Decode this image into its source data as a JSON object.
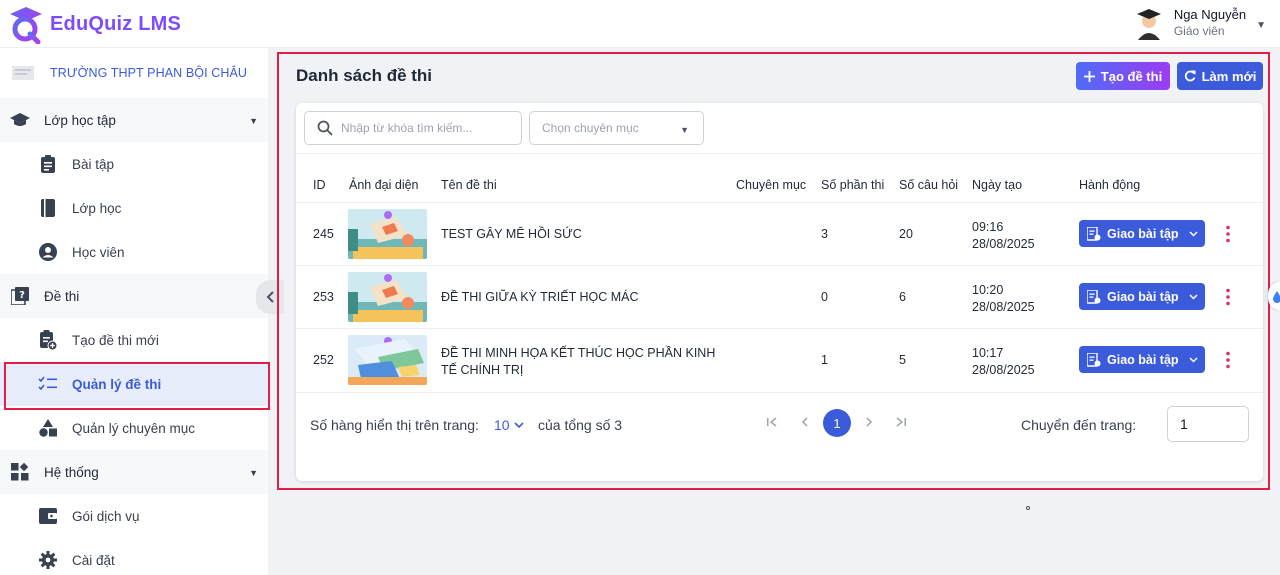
{
  "app": {
    "brand": "EduQuiz LMS"
  },
  "user": {
    "name": "Nga Nguyễn",
    "role": "Giáo viên"
  },
  "sidebar": {
    "school": "TRƯỜNG THPT PHAN BỘI CHÂU",
    "groups": [
      {
        "label": "Lớp học tập",
        "items": [
          "Bài tập",
          "Lớp học",
          "Học viên"
        ]
      },
      {
        "label": "Đề thi",
        "items": [
          "Tạo đề thi mới",
          "Quản lý đề thi",
          "Quản lý chuyên mục"
        ]
      },
      {
        "label": "Hệ thống",
        "items": [
          "Gói dịch vụ",
          "Cài đặt"
        ]
      }
    ],
    "active_item": "Quản lý đề thi"
  },
  "page": {
    "title": "Danh sách đề thi",
    "create_button": "Tạo đề thi",
    "refresh_button": "Làm mới"
  },
  "filters": {
    "search_placeholder": "Nhập từ khóa tìm kiếm...",
    "category_placeholder": "Chọn chuyên mục"
  },
  "table": {
    "columns": [
      "ID",
      "Ảnh đại diện",
      "Tên đề thi",
      "Chuyên mục",
      "Số phần thi",
      "Số câu hỏi",
      "Ngày tạo",
      "Hành động"
    ],
    "rows": [
      {
        "id": "245",
        "name": "TEST GÂY MÊ HỒI SỨC",
        "category": "",
        "parts": "3",
        "questions": "20",
        "time": "09:16",
        "date": "28/08/2025",
        "action": "Giao bài tập"
      },
      {
        "id": "253",
        "name": "ĐỀ THI GIỮA KỲ TRIẾT HỌC MÁC",
        "category": "",
        "parts": "0",
        "questions": "6",
        "time": "10:20",
        "date": "28/08/2025",
        "action": "Giao bài tập"
      },
      {
        "id": "252",
        "name_line1": "ĐỀ THI MINH HỌA KẾT THÚC HỌC PHẦN KINH",
        "name_line2": "TẾ CHÍNH TRỊ",
        "category": "",
        "parts": "1",
        "questions": "5",
        "time": "10:17",
        "date": "28/08/2025",
        "action": "Giao bài tập"
      }
    ]
  },
  "pagination": {
    "rows_per_page_label": "Số hàng hiển thị trên trang:",
    "rows_per_page": "10",
    "total_label": "của tổng số 3",
    "current_page": "1",
    "goto_label": "Chuyển đến trang:",
    "goto_value": "1"
  },
  "colors": {
    "primary": "#3b5bdb",
    "brand": "#7c4dff",
    "highlight_border": "#e11d48"
  }
}
